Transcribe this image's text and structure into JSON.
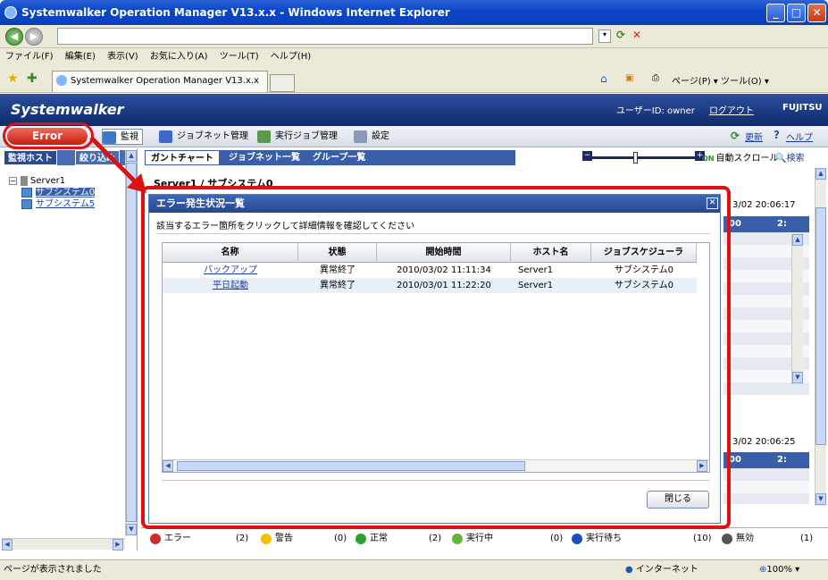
{
  "window": {
    "title": "Systemwalker Operation Manager V13.x.x - Windows Internet Explorer",
    "minimize": "_",
    "maximize": "□",
    "close": "✕"
  },
  "menu": [
    "ファイル(F)",
    "編集(E)",
    "表示(V)",
    "お気に入り(A)",
    "ツール(T)",
    "ヘルプ(H)"
  ],
  "browser_tab": "Systemwalker Operation Manager V13.x.x",
  "browser_tools": "ページ(P) ▾   ツール(O) ▾",
  "header": {
    "logo": "Systemwalker",
    "user_id": "ユーザーID: owner",
    "logout": "ログアウト",
    "brand": "FUJITSU"
  },
  "toolbar": {
    "error": "Error",
    "monitor": "監視",
    "jobnet_mgmt": "ジョブネット管理",
    "exec_job_mgmt": "実行ジョブ管理",
    "settings": "設定",
    "refresh": "更新",
    "help": "ヘルプ"
  },
  "left": {
    "tab_hosts": "監視ホスト",
    "tab_filter": "絞り込み",
    "tree_root": "Server1",
    "tree_items": [
      "サブシステム0",
      "サブシステム5"
    ]
  },
  "subtabs": [
    "ガントチャート",
    "ジョブネット一覧",
    "グループ一覧"
  ],
  "right": {
    "breadcrumb": "Server1 / サブシステム0",
    "auto_scroll": "自動スクロール",
    "search": "検索",
    "on_badge": "ON",
    "bg_date1": "3/02 20:06:17",
    "bg_date2": "3/02 20:06:25",
    "bg_col1": "00",
    "bg_col2": "2:"
  },
  "dialog": {
    "title": "エラー発生状況一覧",
    "message": "該当するエラー箇所をクリックして詳細情報を確認してください",
    "columns": [
      "名称",
      "状態",
      "開始時間",
      "ホスト名",
      "ジョブスケジューラ"
    ],
    "rows": [
      [
        "バックアップ",
        "異常終了",
        "2010/03/02 11:11:34",
        "Server1",
        "サブシステム0"
      ],
      [
        "平日起動",
        "異常終了",
        "2010/03/01 11:22:20",
        "Server1",
        "サブシステム0"
      ]
    ],
    "close_button": "閉じる"
  },
  "status": [
    {
      "label": "エラー",
      "count": "(2)",
      "color": "#d02a2a"
    },
    {
      "label": "警告",
      "count": "(0)",
      "color": "#f2c200"
    },
    {
      "label": "正常",
      "count": "(2)",
      "color": "#2ea02e"
    },
    {
      "label": "実行中",
      "count": "(0)",
      "color": "#66b33a"
    },
    {
      "label": "実行待ち",
      "count": "(10)",
      "color": "#1f4fbf"
    },
    {
      "label": "無効",
      "count": "(1)",
      "color": "#555555"
    }
  ],
  "iestatus": {
    "left": "ページが表示されました",
    "zone": "インターネット",
    "zoom": "100%"
  }
}
